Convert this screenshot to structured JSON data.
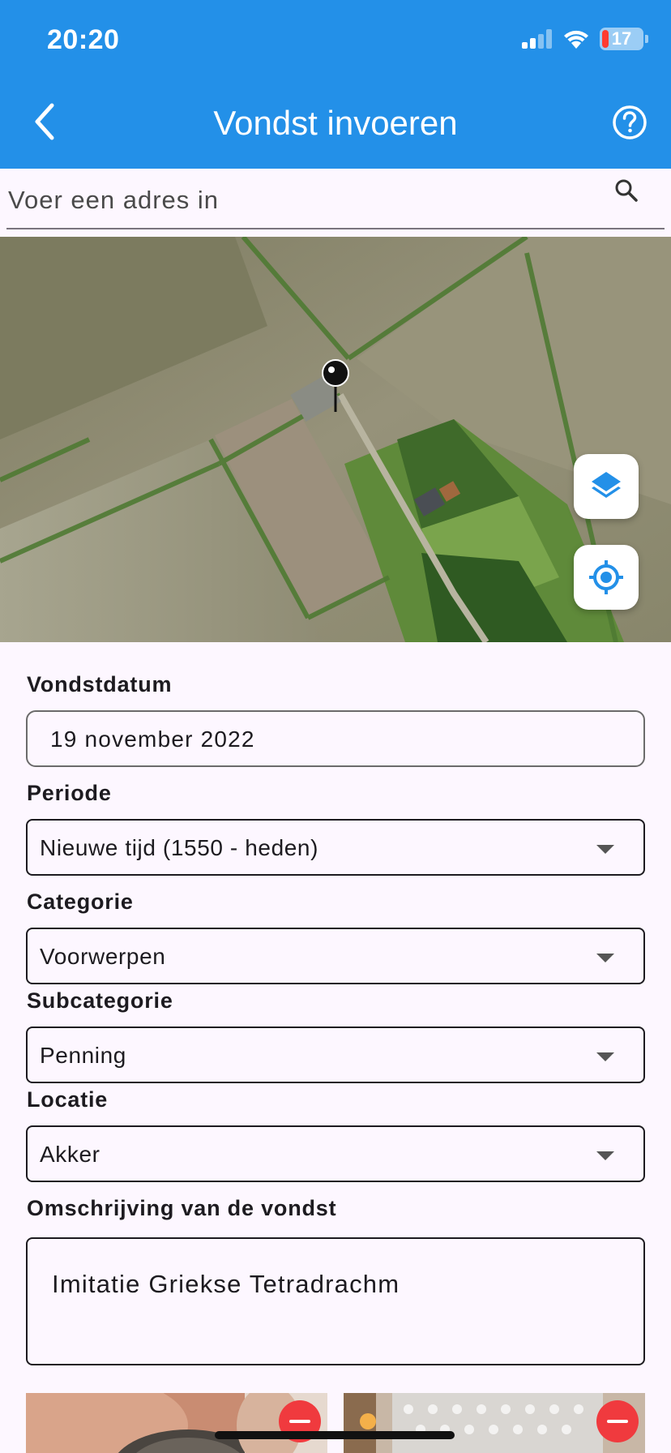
{
  "status_bar": {
    "time": "20:20",
    "battery": "17"
  },
  "header": {
    "title": "Vondst invoeren"
  },
  "search": {
    "placeholder": "Voer een adres in"
  },
  "form": {
    "date_label": "Vondstdatum",
    "date_value": "19 november 2022",
    "period_label": "Periode",
    "period_value": "Nieuwe tijd (1550 - heden)",
    "category_label": "Categorie",
    "category_value": "Voorwerpen",
    "subcategory_label": "Subcategorie",
    "subcategory_value": "Penning",
    "location_label": "Locatie",
    "location_value": "Akker",
    "description_label": "Omschrijving van de vondst",
    "description_value": "Imitatie Griekse Tetradrachm"
  },
  "colors": {
    "app_bar": "#2390e8",
    "accent": "#2390e8",
    "background": "#fdf7ff",
    "remove": "#f03a3e"
  },
  "icons": [
    "chevron-left-icon",
    "help-icon",
    "search-icon",
    "layers-icon",
    "my-location-icon",
    "map-pin-icon",
    "remove-icon"
  ]
}
